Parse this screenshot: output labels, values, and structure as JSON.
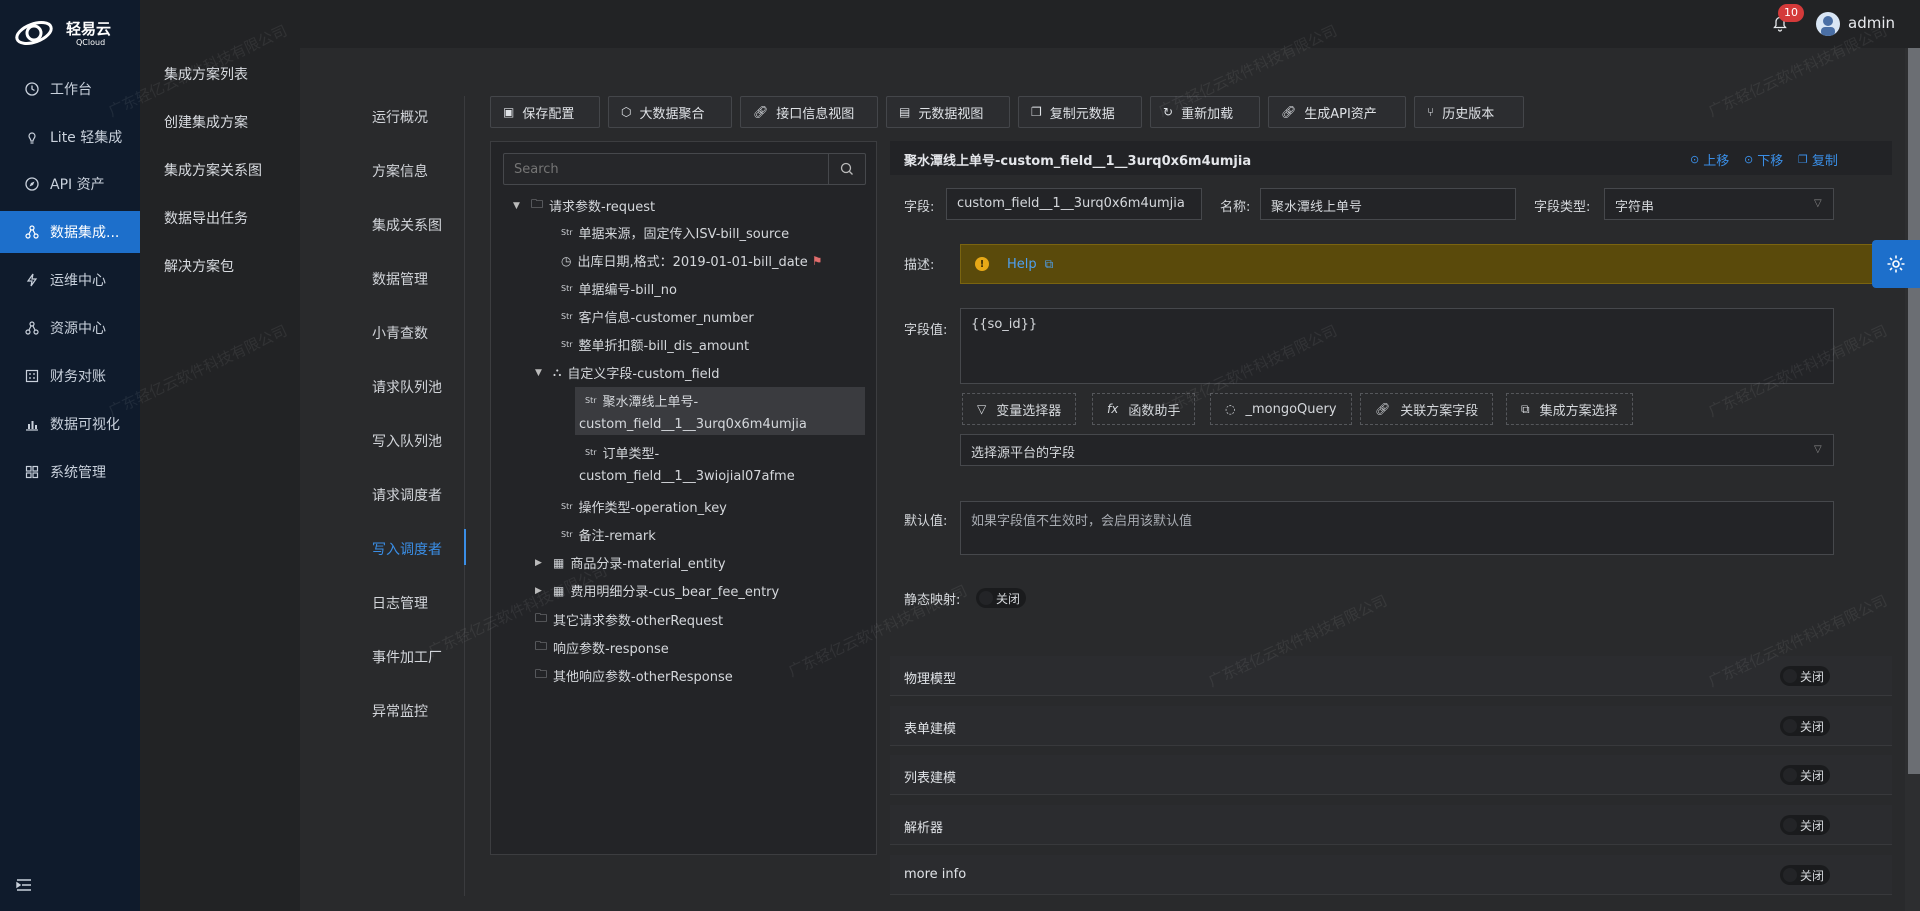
{
  "brand": {
    "name": "轻易云",
    "sub": "QCloud"
  },
  "sidebar": {
    "items": [
      {
        "label": "工作台",
        "icon": "clock-icon"
      },
      {
        "label": "Lite 轻集成",
        "icon": "bulb-icon"
      },
      {
        "label": "API 资产",
        "icon": "compass-icon"
      },
      {
        "label": "数据集成...",
        "icon": "network-icon",
        "active": true
      },
      {
        "label": "运维中心",
        "icon": "bolt-icon"
      },
      {
        "label": "资源中心",
        "icon": "network-icon"
      },
      {
        "label": "财务对账",
        "icon": "calculator-icon"
      },
      {
        "label": "数据可视化",
        "icon": "chart-icon"
      },
      {
        "label": "系统管理",
        "icon": "grid-icon"
      }
    ]
  },
  "subnav": {
    "items": [
      "集成方案列表",
      "创建集成方案",
      "集成方案关系图",
      "数据导出任务",
      "解决方案包"
    ]
  },
  "topbar": {
    "badge": "10",
    "username": "admin"
  },
  "tabs": [
    "运行概况",
    "方案信息",
    "集成关系图",
    "数据管理",
    "小青查数",
    "请求队列池",
    "写入队列池",
    "请求调度者",
    "写入调度者",
    "日志管理",
    "事件加工厂",
    "异常监控"
  ],
  "toolbar": [
    {
      "label": "保存配置",
      "icon": "save-icon"
    },
    {
      "label": "大数据聚合",
      "icon": "cube-icon"
    },
    {
      "label": "接口信息视图",
      "icon": "link-icon"
    },
    {
      "label": "元数据视图",
      "icon": "terminal-icon"
    },
    {
      "label": "复制元数据",
      "icon": "copy-icon"
    },
    {
      "label": "重新加载",
      "icon": "reload-icon"
    },
    {
      "label": "生成API资产",
      "icon": "link-icon"
    },
    {
      "label": "历史版本",
      "icon": "branch-icon"
    }
  ],
  "tree": {
    "search_placeholder": "Search",
    "nodes": {
      "request": "请求参数-request",
      "bill_source": "单据来源，固定传入ISV-bill_source",
      "bill_date": "出库日期,格式：2019-01-01-bill_date",
      "bill_no": "单据编号-bill_no",
      "customer_number": "客户信息-customer_number",
      "bill_dis_amount": "整单折扣额-bill_dis_amount",
      "custom_field": "自定义字段-custom_field",
      "cf1_line1": "聚水潭线上单号-",
      "cf1_line2": "custom_field__1__3urq0x6m4umjia",
      "cf2_line1": "订单类型-",
      "cf2_line2": "custom_field__1__3wiojial07afme",
      "operation_key": "操作类型-operation_key",
      "remark": "备注-remark",
      "material_entity": "商品分录-material_entity",
      "cus_bear_fee_entry": "费用明细分录-cus_bear_fee_entry",
      "otherRequest": "其它请求参数-otherRequest",
      "response": "响应参数-response",
      "otherResponse": "其他响应参数-otherResponse"
    },
    "str_tag": "Str"
  },
  "detail": {
    "title": "聚水潭线上单号-custom_field__1__3urq0x6m4umjia",
    "actions": {
      "up": "上移",
      "down": "下移",
      "copy": "复制"
    },
    "field_label": "字段:",
    "field_value": "custom_field__1__3urq0x6m4umjia",
    "name_label": "名称:",
    "name_value": "聚水潭线上单号",
    "type_label": "字段类型:",
    "type_value": "字符串",
    "desc_label": "描述:",
    "help": "Help",
    "value_label": "字段值:",
    "value": "{{so_id}}",
    "buttons": {
      "var": "变量选择器",
      "func": "函数助手",
      "mongo": "_mongoQuery",
      "rel": "关联方案字段",
      "plan": "集成方案选择"
    },
    "source_select_placeholder": "选择源平台的字段",
    "default_label": "默认值:",
    "default_placeholder": "如果字段值不生效时，会启用该默认值",
    "static_label": "静态映射:",
    "off": "关闭",
    "sections": [
      "物理模型",
      "表单建模",
      "列表建模",
      "解析器",
      "more info"
    ]
  },
  "watermark": "广东轻亿云软件科技有限公司",
  "colors": {
    "accent": "#1d6fcb",
    "link": "#3a8ee6",
    "badge": "#d43a3a",
    "help_bg": "#5a4a0b"
  }
}
